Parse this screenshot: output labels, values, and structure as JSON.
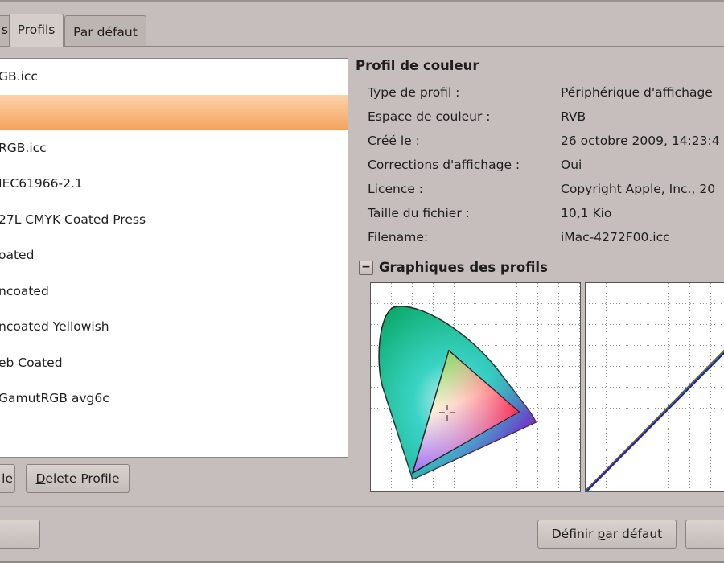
{
  "tabs": [
    {
      "label": "s"
    },
    {
      "label": "Profils"
    },
    {
      "label": "Par défaut"
    }
  ],
  "profiles": [
    {
      "label": "GB.icc"
    },
    {
      "label": ""
    },
    {
      "label": "RGB.icc"
    },
    {
      "label": "IEC61966-2.1"
    },
    {
      "label": "27L CMYK Coated Press"
    },
    {
      "label": "oated"
    },
    {
      "label": "ncoated"
    },
    {
      "label": "ncoated Yellowish"
    },
    {
      "label": "eb Coated"
    },
    {
      "label": "GamutRGB avg6c"
    }
  ],
  "list_buttons": {
    "partial": "le",
    "delete": "Delete Profile",
    "delete_mnemonic": "D",
    "delete_rest": "elete Profile"
  },
  "info": {
    "section_title": "Profil de couleur",
    "rows": [
      {
        "label": "Type de profil :",
        "value": "Périphérique d'affichage"
      },
      {
        "label": "Espace de couleur :",
        "value": "RVB"
      },
      {
        "label": "Créé le :",
        "value": "26 octobre 2009, 14:23:4"
      },
      {
        "label": "Corrections d'affichage :",
        "value": "Oui"
      },
      {
        "label": "Licence :",
        "value": "Copyright Apple, Inc., 20"
      },
      {
        "label": "Taille du fichier :",
        "value": "10,1 Kio"
      },
      {
        "label": "Filename:",
        "value": "iMac-4272F00.icc"
      }
    ]
  },
  "graphs": {
    "toggle": "−",
    "title": "Graphiques des profils"
  },
  "bottom": {
    "set_default_pre": "Définir ",
    "set_default_mnemonic": "p",
    "set_default_post": "ar défaut"
  },
  "colors": {
    "selection": "#f4a25d",
    "background": "#c6bebc"
  }
}
